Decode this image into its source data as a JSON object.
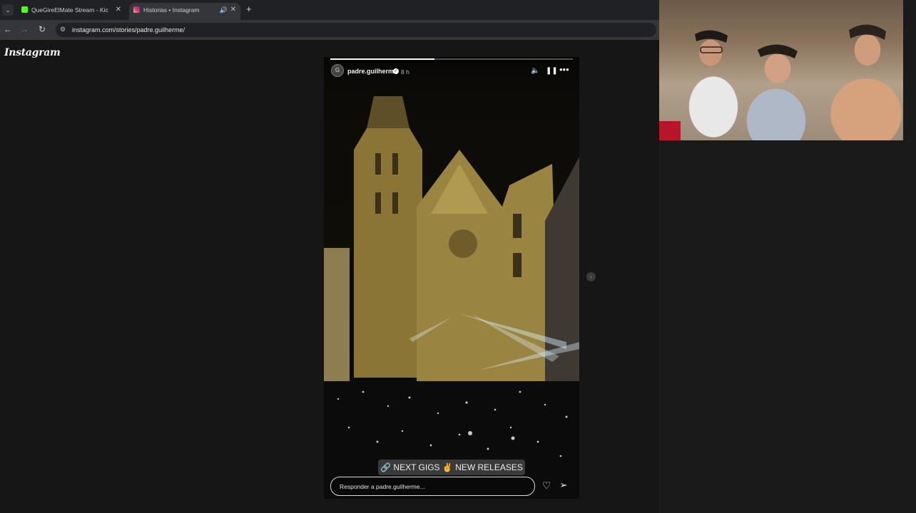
{
  "browser": {
    "tabs": [
      {
        "label": "QueGireElMate Stream - Kick D",
        "active": false
      },
      {
        "label": "Historias • Instagram",
        "active": true
      }
    ],
    "new_tab_icon": "plus-icon",
    "url": "instagram.com/stories/padre.guilherme/"
  },
  "instagram": {
    "logo_text": "Instagram"
  },
  "story": {
    "progress": 0.43,
    "username": "padre.guilherme",
    "time_ago": "8 h",
    "avatar_initial": "G",
    "link_sticker": "🔗 NEXT GIGS ✌ NEW RELEASES",
    "reply_placeholder": "Responder a padre.guilherme..."
  },
  "colors": {
    "tabbar": "#1f2124",
    "toolbar": "#35363a",
    "page_bg": "#161616",
    "kick_green": "#53fc18"
  }
}
